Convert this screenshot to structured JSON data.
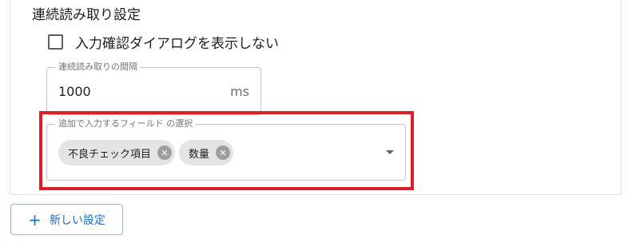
{
  "section": {
    "title": "連続読み取り設定"
  },
  "checkbox": {
    "label": "入力確認ダイアログを表示しない",
    "checked": false
  },
  "interval_field": {
    "legend": "連続読み取りの間隔",
    "value": "1000",
    "unit": "ms"
  },
  "field_select": {
    "legend": "追加で入力するフィールド の選択",
    "chips": [
      {
        "label": "不良チェック項目"
      },
      {
        "label": "数量"
      }
    ],
    "remove_glyph": "✕"
  },
  "new_setting_button": {
    "icon": "+",
    "label": "新しい設定"
  },
  "colors": {
    "highlight": "#d9202a",
    "accent": "#1e6fbf"
  }
}
